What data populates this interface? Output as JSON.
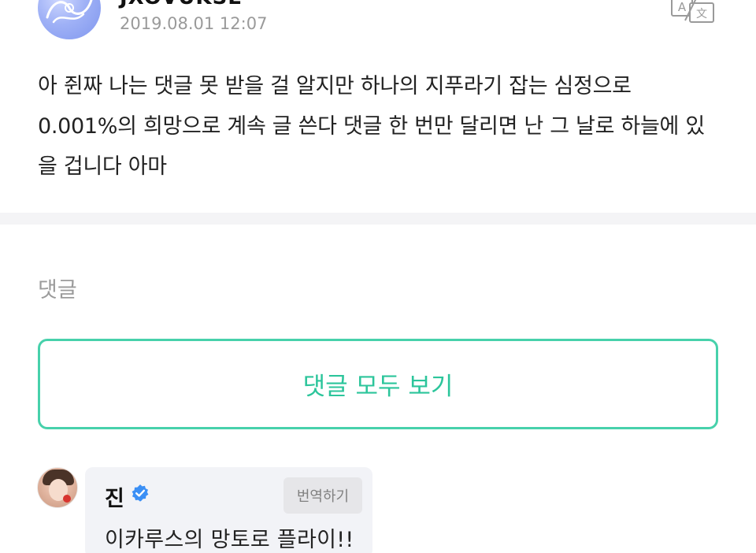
{
  "post": {
    "author": "JXOVUKSE",
    "timestamp": "2019.08.01 12:07",
    "translate_icon": "translate-icon",
    "body": "아 쥔짜 나는 댓글 못 받을 걸 알지만 하나의 지푸라기 잡는 심정으로 0.001%의 희망으로 계속 글 쓴다 댓글 한 번만 달리면 난 그 날로 하늘에 있을 겁니다 아마"
  },
  "comments_section": {
    "title": "댓글",
    "view_all_label": "댓글 모두 보기"
  },
  "comment": {
    "author": "진",
    "verified_icon": "verified-badge-icon",
    "translate_label": "번역하기",
    "text": "이카루스의 망토로 플라이!!"
  },
  "colors": {
    "accent": "#2cc59b",
    "accent_border": "#47d1ab",
    "verified": "#3b8ff5",
    "muted_text": "#9b9b9b",
    "bubble": "#f2f3f7"
  }
}
